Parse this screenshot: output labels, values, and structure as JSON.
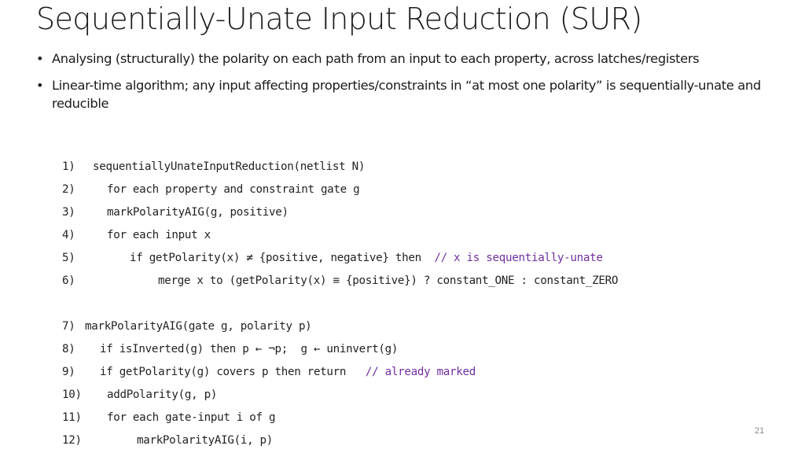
{
  "slide": {
    "title": "Sequentially-Unate Input Reduction (SUR)",
    "bullets": [
      "Analysing (structurally) the polarity on each path from an input to each property, across latches/registers",
      "Linear-time algorithm; any input affecting properties/constraints in “at most one polarity” is sequentially-unate and reducible"
    ],
    "bullet_symbol": "•",
    "code_lines": [
      {
        "num": "1)",
        "code": "sequentiallyUnateInputReduction(netlist N)",
        "comment": ""
      },
      {
        "num": "2)",
        "code": "for each property and constraint gate g",
        "comment": ""
      },
      {
        "num": "3)",
        "code": "markPolarityAIG(g, positive)",
        "comment": ""
      },
      {
        "num": "4)",
        "code": "for each input x",
        "comment": ""
      },
      {
        "num": "5)",
        "code": "if getPolarity(x) ≠ {positive, negative} then",
        "comment": "// x is sequentially-unate"
      },
      {
        "num": "6)",
        "code": "merge x to (getPolarity(x) ≡ {positive}) ? constant_ONE : constant_ZERO",
        "comment": ""
      },
      {
        "num": "7)",
        "code": "markPolarityAIG(gate g, polarity p)",
        "comment": ""
      },
      {
        "num": "8)",
        "code": "if isInverted(g) then p ← ¬p;  g ← uninvert(g)",
        "comment": ""
      },
      {
        "num": "9)",
        "code": "if getPolarity(g) covers p then return",
        "comment": "// already marked"
      },
      {
        "num": "10)",
        "code": "addPolarity(g, p)",
        "comment": ""
      },
      {
        "num": "11)",
        "code": "for each gate-input i of g",
        "comment": ""
      },
      {
        "num": "12)",
        "code": "markPolarityAIG(i, p)",
        "comment": ""
      }
    ],
    "comment_color": "#7030a0",
    "page_number": "21"
  }
}
